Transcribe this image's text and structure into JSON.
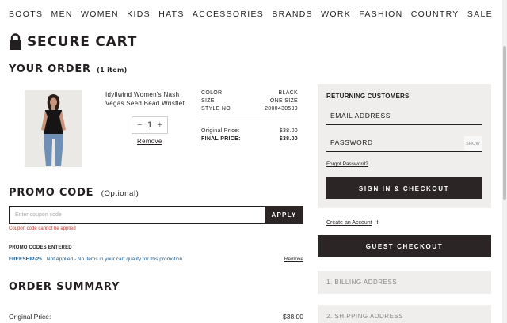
{
  "nav": {
    "items": [
      "BOOTS",
      "MEN",
      "WOMEN",
      "KIDS",
      "HATS",
      "ACCESSORIES",
      "BRANDS",
      "WORK",
      "FASHION",
      "COUNTRY",
      "SALE"
    ]
  },
  "page": {
    "title": "SECURE CART",
    "lock_icon": "lock-icon"
  },
  "order": {
    "heading": "YOUR ORDER",
    "count": "(1 item)",
    "product": {
      "name": "Idyllwind Women's Nash Vegas Seed Bead Wristlet",
      "quantity": "1",
      "minus": "−",
      "plus": "+",
      "remove_label": "Remove",
      "specs": [
        {
          "label": "COLOR",
          "value": "BLACK"
        },
        {
          "label": "SIZE",
          "value": "ONE SIZE"
        },
        {
          "label": "STYLE NO",
          "value": "2000430599"
        }
      ],
      "original_price_label": "Original Price:",
      "original_price": "$38.00",
      "final_price_label": "FINAL PRICE:",
      "final_price": "$38.00"
    }
  },
  "promo": {
    "heading": "PROMO CODE",
    "optional": "(Optional)",
    "input_placeholder": "Enter coupon code",
    "apply_label": "APPLY",
    "error": "Coupon code cannot be applied",
    "entered_title": "PROMO CODES ENTERED",
    "entries": [
      {
        "code": "FREESHIP-25",
        "status": "Not Applied - No items in your cart qualify for this promotion.",
        "remove": "Remove"
      }
    ]
  },
  "summary": {
    "heading": "ORDER SUMMARY",
    "original_price_label": "Original Price:",
    "original_price": "$38.00"
  },
  "returning": {
    "title": "RETURNING CUSTOMERS",
    "email_label": "EMAIL ADDRESS",
    "password_label": "PASSWORD",
    "show_label": "SHOW",
    "forgot_label": "Forgot Password?",
    "signin_label": "SIGN IN & CHECKOUT"
  },
  "checkout": {
    "create_account_label": "Create an Account",
    "create_account_plus": "+",
    "guest_label": "GUEST CHECKOUT",
    "steps": [
      "1. BILLING ADDRESS",
      "2. SHIPPING ADDRESS"
    ]
  },
  "colors": {
    "dark_button": "#2b2525",
    "panel_bg": "#efeeec",
    "error_red": "#c0392b",
    "link_blue": "#1a5b8e"
  }
}
